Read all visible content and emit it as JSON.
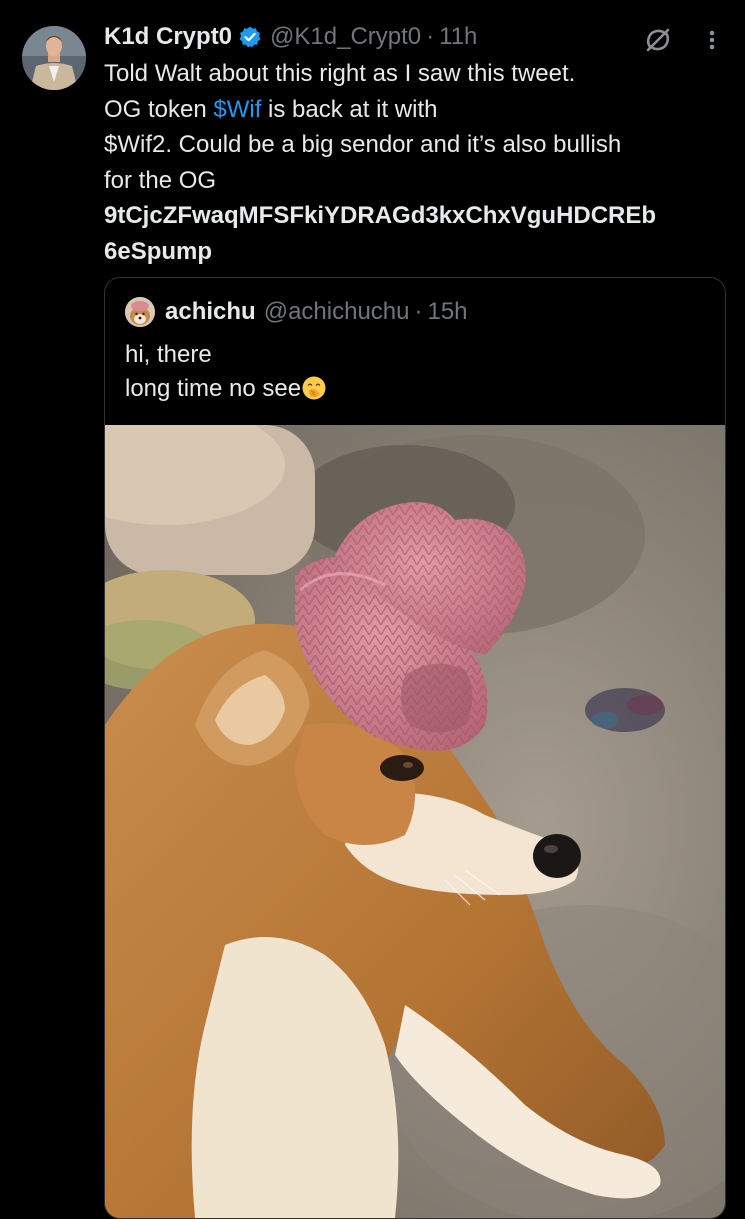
{
  "post": {
    "author": {
      "display_name": "K1d Crypt0",
      "handle": "@K1d_Crypt0",
      "separator": "·",
      "time": "11h",
      "verified": true,
      "avatar_icon": "profile-photo-man-suit"
    },
    "actions": {
      "grok_icon": "grok-icon",
      "more_icon": "more-vertical-icon"
    },
    "text": {
      "line1": "Told Walt about this right as I saw this tweet.",
      "line2_pre": "OG token ",
      "line2_cashtag": "$Wif",
      "line2_post": " is back at it with",
      "line3": "$Wif2. Could be a big sendor and it’s also bullish",
      "line4": "for the OG",
      "ca_line1": "9tCjcZFwaqMFSFkiYDRAGd3kxChxVguHDCREb",
      "ca_line2": "6eSpump"
    },
    "quoted": {
      "display_name": "achichu",
      "handle": "@achichuchu",
      "separator": "·",
      "time": "15h",
      "avatar_icon": "shiba-avatar",
      "text_line1": "hi, there",
      "text_line2": "long time no see",
      "emoji_icon": "face-with-hand-over-mouth-emoji",
      "image": "photo-shiba-inu-pink-knit-cowboy-hat"
    }
  },
  "colors": {
    "background": "#000000",
    "text": "#e7e9ea",
    "secondary": "#71767b",
    "link": "#1d9bf0",
    "border": "#2f3336",
    "verified": "#1d9bf0"
  }
}
